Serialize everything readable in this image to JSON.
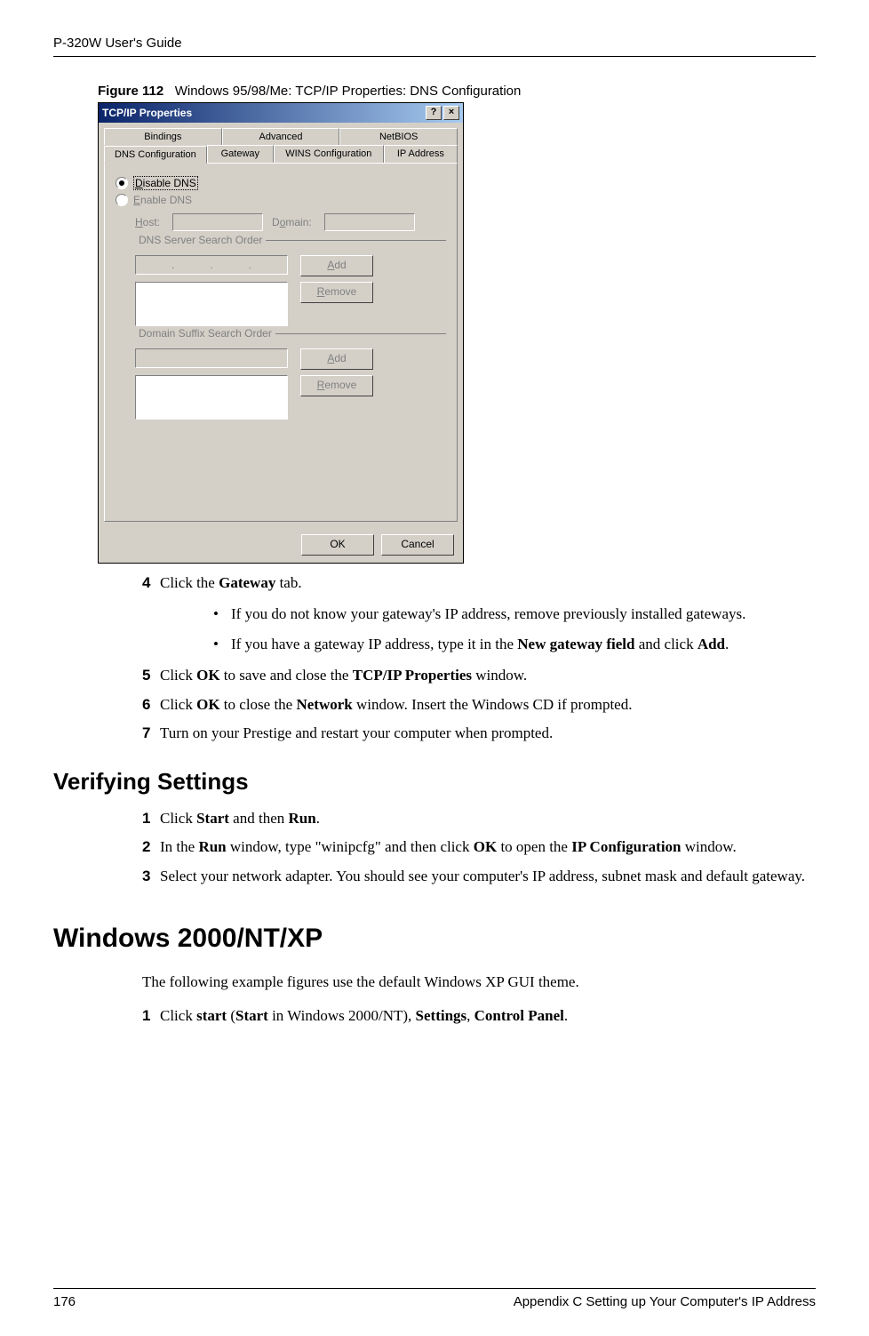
{
  "header": {
    "title": "P-320W User's Guide"
  },
  "figure": {
    "num": "Figure 112",
    "caption": "Windows 95/98/Me: TCP/IP Properties: DNS Configuration"
  },
  "dialog": {
    "title": "TCP/IP Properties",
    "help_btn": "?",
    "close_btn": "×",
    "tabs_row1": [
      "Bindings",
      "Advanced",
      "NetBIOS"
    ],
    "tabs_row2": [
      "DNS Configuration",
      "Gateway",
      "WINS Configuration",
      "IP Address"
    ],
    "radio_disable_prefix": "D",
    "radio_disable_rest": "isable DNS",
    "radio_enable_prefix": "E",
    "radio_enable_rest": "nable DNS",
    "host_prefix": "H",
    "host_rest": "ost:",
    "domain_prefix": "D",
    "domain_rest": "omain:",
    "group1": "DNS Server Search Order",
    "group2": "Domain Suffix Search Order",
    "add_btn_prefix": "A",
    "add_btn_rest": "dd",
    "remove_btn_prefix": "R",
    "remove_btn_rest": "emove",
    "ok": "OK",
    "cancel": "Cancel",
    "dot": "."
  },
  "steps_a": {
    "s4_num": "4",
    "s4_text_a": "Click the ",
    "s4_bold": "Gateway",
    "s4_text_b": " tab.",
    "b1": "If you do not know your gateway's IP address, remove previously installed gateways.",
    "b2_a": "If you have a gateway IP address, type it in the ",
    "b2_bold1": "New gateway field",
    "b2_b": " and click ",
    "b2_bold2": "Add",
    "b2_c": ".",
    "s5_num": "5",
    "s5_a": "Click ",
    "s5_bold1": "OK",
    "s5_b": " to save and close the ",
    "s5_bold2": "TCP/IP Properties",
    "s5_c": " window.",
    "s6_num": "6",
    "s6_a": "Click ",
    "s6_bold1": "OK",
    "s6_b": " to close the ",
    "s6_bold2": "Network",
    "s6_c": " window. Insert the Windows CD if prompted.",
    "s7_num": "7",
    "s7": "Turn on your Prestige and restart your computer when prompted."
  },
  "h2": "Verifying Settings",
  "verify": {
    "s1_num": "1",
    "s1_a": "Click ",
    "s1_bold1": "Start",
    "s1_b": " and then ",
    "s1_bold2": "Run",
    "s1_c": ".",
    "s2_num": "2",
    "s2_a": "In the ",
    "s2_bold1": "Run",
    "s2_b": " window, type \"winipcfg\" and then click ",
    "s2_bold2": "OK",
    "s2_c": " to open the ",
    "s2_bold3": "IP Configuration",
    "s2_d": " window.",
    "s3_num": "3",
    "s3": "Select your network adapter. You should see your computer's IP address, subnet mask and default gateway."
  },
  "h1": "Windows 2000/NT/XP",
  "para1": "The following example figures use the default Windows XP GUI theme.",
  "xp": {
    "s1_num": "1",
    "s1_a": "Click ",
    "s1_bold1": "start",
    "s1_b": " (",
    "s1_bold2": "Start",
    "s1_c": " in Windows 2000/NT), ",
    "s1_bold3": "Settings",
    "s1_d": ", ",
    "s1_bold4": "Control Panel",
    "s1_e": "."
  },
  "footer": {
    "page": "176",
    "section": "Appendix C Setting up Your Computer's IP Address"
  }
}
